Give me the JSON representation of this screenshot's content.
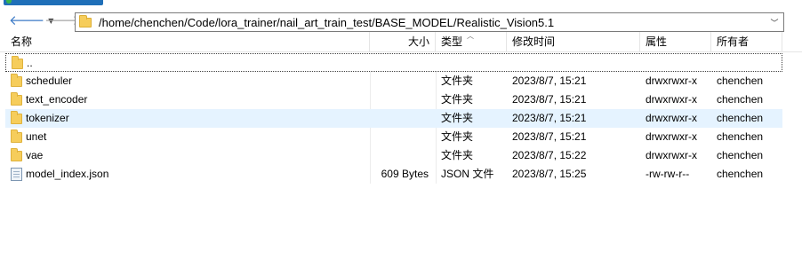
{
  "address": {
    "path": "/home/chenchen/Code/lora_trainer/nail_art_train_test/BASE_MODEL/Realistic_Vision5.1"
  },
  "nav": {
    "back_icon": "arrow-left",
    "forward_icon": "arrow-right",
    "dropdown_icon": "chevron-down"
  },
  "columns": {
    "name": "名称",
    "size": "大小",
    "type": "类型",
    "modified": "修改时间",
    "permissions": "属性",
    "owner": "所有者"
  },
  "sort": {
    "column": "type",
    "direction": "ascending"
  },
  "files": [
    {
      "name": "..",
      "size": "",
      "type": "",
      "modified": "",
      "permissions": "",
      "owner": "",
      "icon": "folder-icon"
    },
    {
      "name": "scheduler",
      "size": "",
      "type": "文件夹",
      "modified": "2023/8/7, 15:21",
      "permissions": "drwxrwxr-x",
      "owner": "chenchen",
      "icon": "folder-icon"
    },
    {
      "name": "text_encoder",
      "size": "",
      "type": "文件夹",
      "modified": "2023/8/7, 15:21",
      "permissions": "drwxrwxr-x",
      "owner": "chenchen",
      "icon": "folder-icon"
    },
    {
      "name": "tokenizer",
      "size": "",
      "type": "文件夹",
      "modified": "2023/8/7, 15:21",
      "permissions": "drwxrwxr-x",
      "owner": "chenchen",
      "icon": "folder-icon"
    },
    {
      "name": "unet",
      "size": "",
      "type": "文件夹",
      "modified": "2023/8/7, 15:21",
      "permissions": "drwxrwxr-x",
      "owner": "chenchen",
      "icon": "folder-icon"
    },
    {
      "name": "vae",
      "size": "",
      "type": "文件夹",
      "modified": "2023/8/7, 15:22",
      "permissions": "drwxrwxr-x",
      "owner": "chenchen",
      "icon": "folder-icon"
    },
    {
      "name": "model_index.json",
      "size": "609 Bytes",
      "type": "JSON 文件",
      "modified": "2023/8/7, 15:25",
      "permissions": "-rw-rw-r--",
      "owner": "chenchen",
      "icon": "file-icon"
    }
  ],
  "colors": {
    "hover_row": "#e5f3ff",
    "folder": "#f6cd5b",
    "back_arrow": "#3d7bc7"
  }
}
